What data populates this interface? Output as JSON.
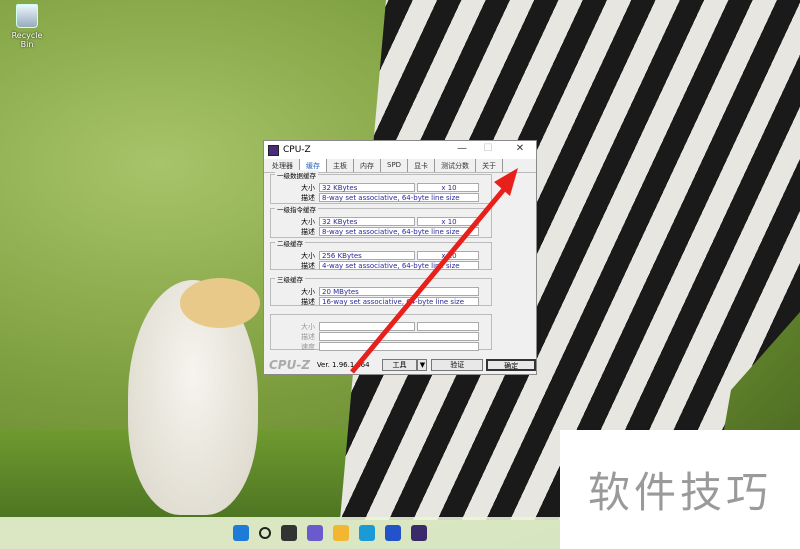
{
  "desktop": {
    "recycle_bin": "Recycle Bin"
  },
  "window": {
    "title": "CPU-Z",
    "minimize": "—",
    "maximize": "☐",
    "close": "✕",
    "tabs": [
      "处理器",
      "缓存",
      "主板",
      "内存",
      "SPD",
      "显卡",
      "测试分数",
      "关于"
    ],
    "active_tab": 1,
    "groups": [
      {
        "label": "一级数据缓存",
        "size": "32 KBytes",
        "count": "x 10",
        "desc": "8-way set associative, 64-byte line size"
      },
      {
        "label": "一级指令缓存",
        "size": "32 KBytes",
        "count": "x 10",
        "desc": "8-way set associative, 64-byte line size"
      },
      {
        "label": "二级缓存",
        "size": "256 KBytes",
        "count": "x 10",
        "desc": "4-way set associative, 64-byte line size"
      },
      {
        "label": "三级缓存",
        "size": "20 MBytes",
        "desc": "16-way set associative, 64-byte line size"
      }
    ],
    "labels": {
      "size": "大小",
      "desc": "描述",
      "speed": "速度"
    },
    "footer": {
      "logo": "CPU-Z",
      "version": "Ver. 1.96.1.x64",
      "tools": "工具",
      "dropdown": "▼",
      "validate": "验证",
      "ok": "确定"
    }
  },
  "taskbar": {
    "icons": [
      "start-icon",
      "search-icon",
      "task-view-icon",
      "chat-icon",
      "file-explorer-icon",
      "edge-icon",
      "security-icon",
      "cpu-z-icon"
    ]
  },
  "watermark": "软件技巧",
  "colors": {
    "arrow": "#e8201c",
    "accent": "#1a5fc0"
  }
}
